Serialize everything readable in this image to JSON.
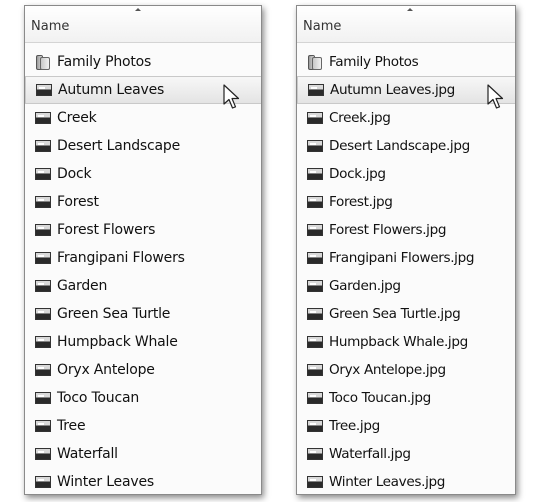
{
  "left_panel": {
    "column_header": "Name",
    "items": [
      {
        "name": "Family Photos",
        "type": "folder"
      },
      {
        "name": "Autumn Leaves",
        "type": "image",
        "highlighted": true
      },
      {
        "name": "Creek",
        "type": "image"
      },
      {
        "name": "Desert Landscape",
        "type": "image"
      },
      {
        "name": "Dock",
        "type": "image"
      },
      {
        "name": "Forest",
        "type": "image"
      },
      {
        "name": "Forest Flowers",
        "type": "image"
      },
      {
        "name": "Frangipani Flowers",
        "type": "image"
      },
      {
        "name": "Garden",
        "type": "image"
      },
      {
        "name": "Green Sea Turtle",
        "type": "image"
      },
      {
        "name": "Humpback Whale",
        "type": "image"
      },
      {
        "name": "Oryx Antelope",
        "type": "image"
      },
      {
        "name": "Toco Toucan",
        "type": "image"
      },
      {
        "name": "Tree",
        "type": "image"
      },
      {
        "name": "Waterfall",
        "type": "image"
      },
      {
        "name": "Winter Leaves",
        "type": "image"
      }
    ]
  },
  "right_panel": {
    "column_header": "Name",
    "items": [
      {
        "name": "Family Photos",
        "type": "folder"
      },
      {
        "name": "Autumn Leaves.jpg",
        "type": "image",
        "highlighted": true
      },
      {
        "name": "Creek.jpg",
        "type": "image"
      },
      {
        "name": "Desert Landscape.jpg",
        "type": "image"
      },
      {
        "name": "Dock.jpg",
        "type": "image"
      },
      {
        "name": "Forest.jpg",
        "type": "image"
      },
      {
        "name": "Forest Flowers.jpg",
        "type": "image"
      },
      {
        "name": "Frangipani Flowers.jpg",
        "type": "image"
      },
      {
        "name": "Garden.jpg",
        "type": "image"
      },
      {
        "name": "Green Sea Turtle.jpg",
        "type": "image"
      },
      {
        "name": "Humpback Whale.jpg",
        "type": "image"
      },
      {
        "name": "Oryx Antelope.jpg",
        "type": "image"
      },
      {
        "name": "Toco Toucan.jpg",
        "type": "image"
      },
      {
        "name": "Tree.jpg",
        "type": "image"
      },
      {
        "name": "Waterfall.jpg",
        "type": "image"
      },
      {
        "name": "Winter Leaves.jpg",
        "type": "image"
      }
    ]
  },
  "icons": {
    "folder": "folder-icon",
    "image": "image-file-icon",
    "pointer": "mouse-pointer-icon"
  }
}
